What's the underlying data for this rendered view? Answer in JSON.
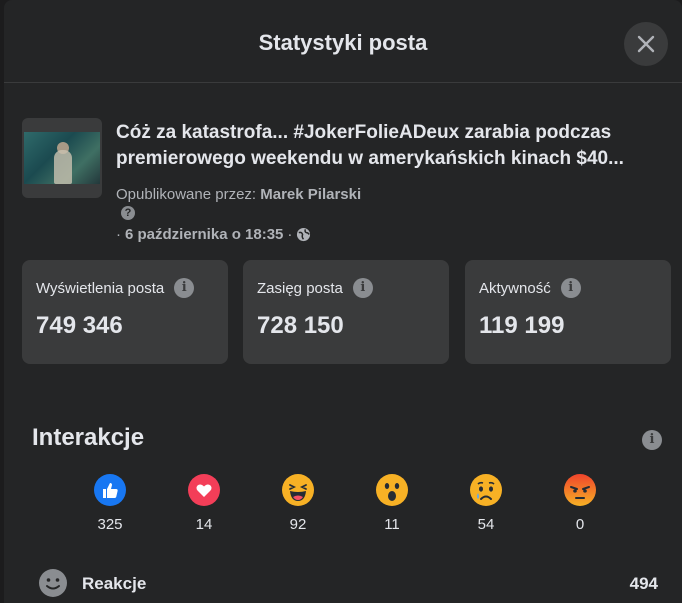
{
  "header": {
    "title": "Statystyki posta"
  },
  "post": {
    "title_line1": "Cóż za katastrofa... #JokerFolieADeux zarabia podczas",
    "title_line2": "premierowego weekendu w amerykańskich kinach $40...",
    "published_by_label": "Opublikowane przez:",
    "author": "Marek Pilarski",
    "help_mark": "?",
    "date_prefix": "·",
    "date": "6 października o 18:35",
    "date_suffix": "·"
  },
  "stats": [
    {
      "label": "Wyświetlenia posta",
      "value": "749 346"
    },
    {
      "label": "Zasięg posta",
      "value": "728 150"
    },
    {
      "label": "Aktywność",
      "value": "119 199"
    }
  ],
  "interactions": {
    "title": "Interakcje",
    "reactions": [
      {
        "name": "like",
        "count": "325"
      },
      {
        "name": "love",
        "count": "14"
      },
      {
        "name": "haha",
        "count": "92"
      },
      {
        "name": "wow",
        "count": "11"
      },
      {
        "name": "sad",
        "count": "54"
      },
      {
        "name": "angry",
        "count": "0"
      }
    ],
    "row": {
      "label": "Reakcje",
      "value": "494"
    }
  },
  "colors": {
    "background": "#242526",
    "card": "#3a3b3c",
    "like": "#1877f2",
    "love": "#f33e58",
    "emoji": "#f7b125",
    "angry": "#e9710f"
  }
}
